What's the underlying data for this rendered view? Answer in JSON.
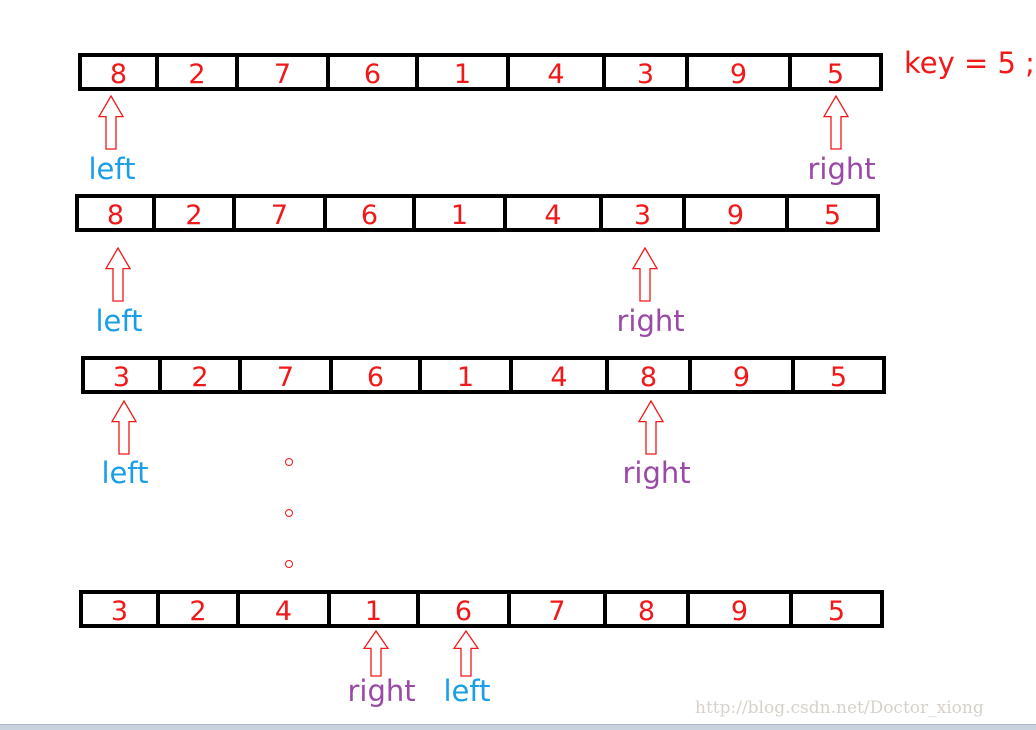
{
  "key_label": "key = 5 ;",
  "steps": [
    {
      "values": [
        "8",
        "2",
        "7",
        "6",
        "1",
        "4",
        "3",
        "9",
        "5"
      ],
      "pointers": [
        {
          "label": "left",
          "index": 0,
          "type": "left"
        },
        {
          "label": "right",
          "index": 8,
          "type": "right"
        }
      ]
    },
    {
      "values": [
        "8",
        "2",
        "7",
        "6",
        "1",
        "4",
        "3",
        "9",
        "5"
      ],
      "pointers": [
        {
          "label": "left",
          "index": 0,
          "type": "left"
        },
        {
          "label": "right",
          "index": 6,
          "type": "right"
        }
      ]
    },
    {
      "values": [
        "3",
        "2",
        "7",
        "6",
        "1",
        "4",
        "8",
        "9",
        "5"
      ],
      "pointers": [
        {
          "label": "left",
          "index": 0,
          "type": "left"
        },
        {
          "label": "right",
          "index": 6,
          "type": "right"
        }
      ]
    },
    {
      "values": [
        "3",
        "2",
        "4",
        "1",
        "6",
        "7",
        "8",
        "9",
        "5"
      ],
      "pointers": [
        {
          "label": "right",
          "index": 3,
          "type": "right"
        },
        {
          "label": "left",
          "index": 4,
          "type": "left"
        }
      ]
    }
  ],
  "ellipsis": "continued steps",
  "watermark": "http://blog.csdn.net/Doctor_xiong",
  "colors": {
    "values": "#f01818",
    "left": "#1a9fe6",
    "right": "#9a4aa6",
    "arrow": "#f01818",
    "border": "#000000"
  }
}
